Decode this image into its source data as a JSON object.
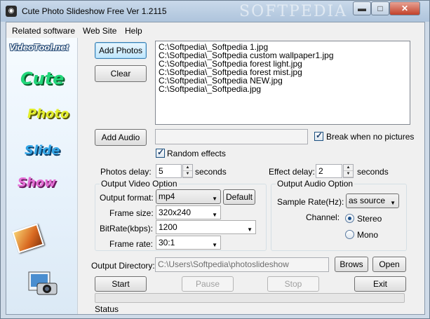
{
  "window": {
    "title": "Cute Photo Slideshow Free Ver 1.2115",
    "watermark": "SOFTPEDIA",
    "controls": {
      "minimize": "▬",
      "maximize": "□",
      "close": "✕"
    }
  },
  "menu": [
    "Related software",
    "Web Site",
    "Help"
  ],
  "sidebar": {
    "site": "VideoTool.net",
    "words": [
      "Cute",
      "Photo",
      "Slide",
      "Show"
    ]
  },
  "buttons": {
    "add_photos": "Add Photos",
    "clear": "Clear",
    "add_audio": "Add Audio",
    "default": "Default",
    "brows": "Brows",
    "open": "Open",
    "start": "Start",
    "pause": "Pause",
    "stop": "Stop",
    "exit": "Exit"
  },
  "photo_list": [
    "C:\\Softpedia\\_Softpedia 1.jpg",
    "C:\\Softpedia\\_Softpedia custom wallpaper1.jpg",
    "C:\\Softpedia\\_Softpedia forest light.jpg",
    "C:\\Softpedia\\_Softpedia forest mist.jpg",
    "C:\\Softpedia\\_Softpedia NEW.jpg",
    "C:\\Softpedia\\_Softpedia.jpg"
  ],
  "audio": {
    "path": "",
    "break_label": "Break when no pictures",
    "break_checked": true
  },
  "random_effects": {
    "label": "Random effects",
    "checked": true
  },
  "photos_delay": {
    "label": "Photos delay:",
    "value": "5",
    "unit": "seconds"
  },
  "effect_delay": {
    "label": "Effect delay:",
    "value": "2",
    "unit": "seconds"
  },
  "video": {
    "group_title": "Output Video Option",
    "format_label": "Output format:",
    "format_value": "mp4",
    "size_label": "Frame size:",
    "size_value": "320x240",
    "bitrate_label": "BitRate(kbps):",
    "bitrate_value": "1200",
    "framerate_label": "Frame rate:",
    "framerate_value": "30:1"
  },
  "audio_opt": {
    "group_title": "Output Audio Option",
    "sample_label": "Sample Rate(Hz):",
    "sample_value": "as source",
    "channel_label": "Channel:",
    "stereo": "Stereo",
    "mono": "Mono",
    "selected": "Stereo"
  },
  "output": {
    "label": "Output Directory:",
    "path": "C:\\Users\\Softpedia\\photoslideshow"
  },
  "progress": 0,
  "status": "Status",
  "colors": {
    "progress_fill": "#06b025",
    "accent": "#3c7fb1"
  }
}
